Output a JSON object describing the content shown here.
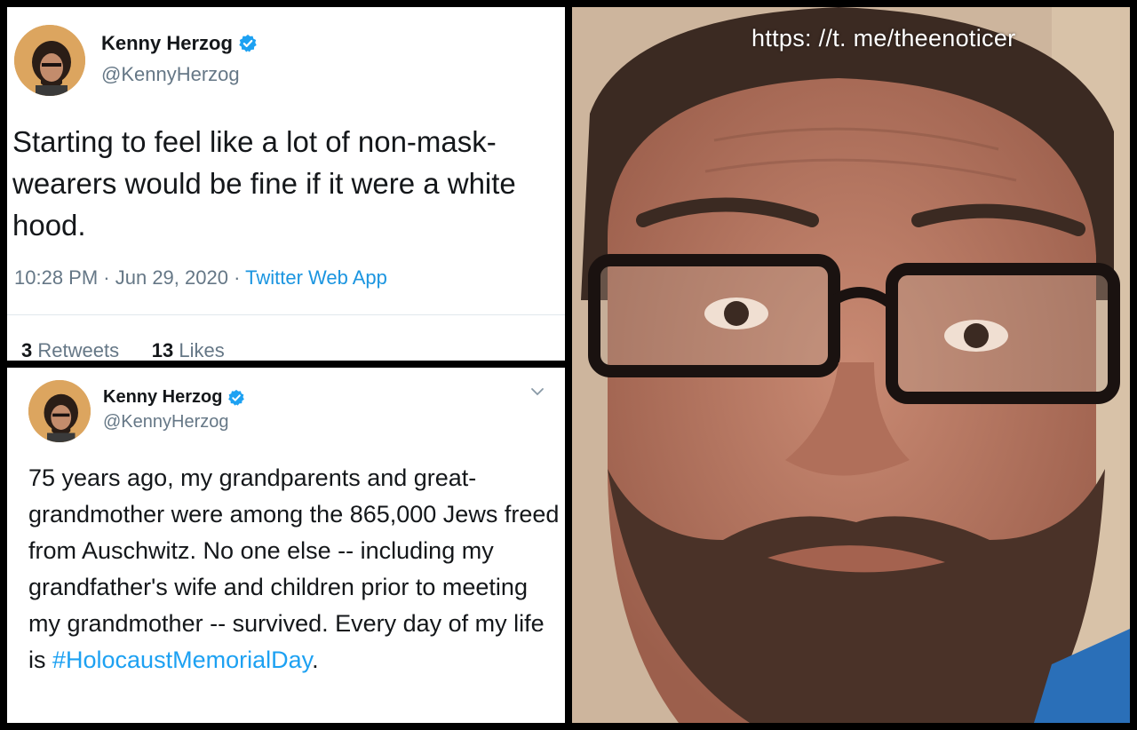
{
  "tweet_top": {
    "name": "Kenny Herzog",
    "handle": "@KennyHerzog",
    "text": "Starting to feel like a lot of non-mask-wearers would be fine if it were a white hood.",
    "time": "10:28 PM",
    "separator1": " · ",
    "date": "Jun 29, 2020",
    "separator2": " · ",
    "source": "Twitter Web App",
    "retweets_count": "3",
    "retweets_label": "Retweets",
    "likes_count": "13",
    "likes_label": "Likes"
  },
  "tweet_bottom": {
    "name": "Kenny Herzog",
    "handle": "@KennyHerzog",
    "text_before_hashtag": "75 years ago, my grandparents and great-grandmother were among the 865,000 Jews freed from Auschwitz. No one else -- including my grandfather's wife and children prior to meeting my grandmother -- survived. Every day of my life is ",
    "hashtag": "#HolocaustMemorialDay",
    "text_after_hashtag": "."
  },
  "watermark": "https: //t. me/theenoticer",
  "icons": {
    "verified": "verified-badge-icon",
    "chevron": "chevron-down-icon"
  },
  "colors": {
    "twitter_blue": "#1da1f2",
    "text_dark": "#14171a",
    "text_gray": "#657786"
  }
}
